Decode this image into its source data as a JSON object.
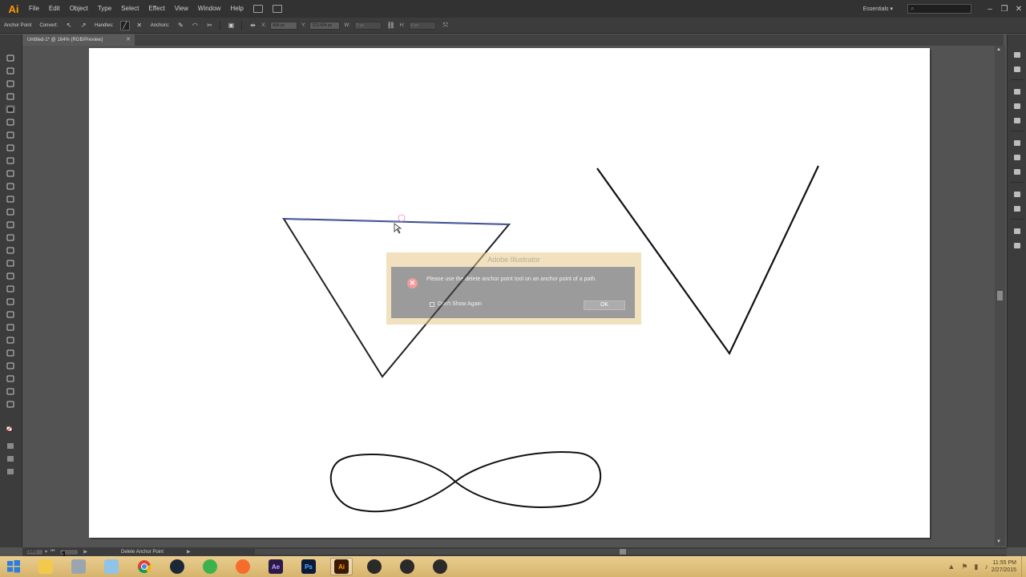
{
  "app": {
    "logo_text": "Ai",
    "document_tab": "Untitled-1* @ 164% (RGB/Preview)",
    "workspace": "Essentials ▾"
  },
  "menu": [
    "File",
    "Edit",
    "Object",
    "Type",
    "Select",
    "Effect",
    "View",
    "Window",
    "Help"
  ],
  "controlbar": {
    "tool_label": "Anchor Point",
    "convert_label": "Convert:",
    "handles_label": "Handles:",
    "anchors_label": "Anchors:",
    "x_value": "468 px",
    "y_value": "223.404 px",
    "w_value": "0 px",
    "h_value": "0 px"
  },
  "dialog": {
    "title": "Adobe Illustrator",
    "message": "Please use the delete anchor point tool on an anchor point of a path.",
    "checkbox_label": "Don't Show Again",
    "ok_label": "OK"
  },
  "status": {
    "zoom": "164%",
    "artboard": "1",
    "current_tool": "Delete Anchor Point"
  },
  "taskbar": {
    "apps": [
      "file-explorer",
      "settings-tool",
      "notepad",
      "chrome",
      "steam",
      "spotify",
      "origin",
      "after-effects",
      "photoshop",
      "illustrator",
      "app-1",
      "app-2",
      "app-3"
    ],
    "app_labels": {
      "after_effects": "Ae",
      "photoshop": "Ps",
      "illustrator": "Ai"
    },
    "time": "11:55 PM",
    "date": "2/27/2015"
  },
  "colors": {
    "accent": "#ff9a00",
    "selection": "#4a6ad4",
    "dialog_frame": "#e6c98a",
    "taskbar": "#e0c07d"
  }
}
